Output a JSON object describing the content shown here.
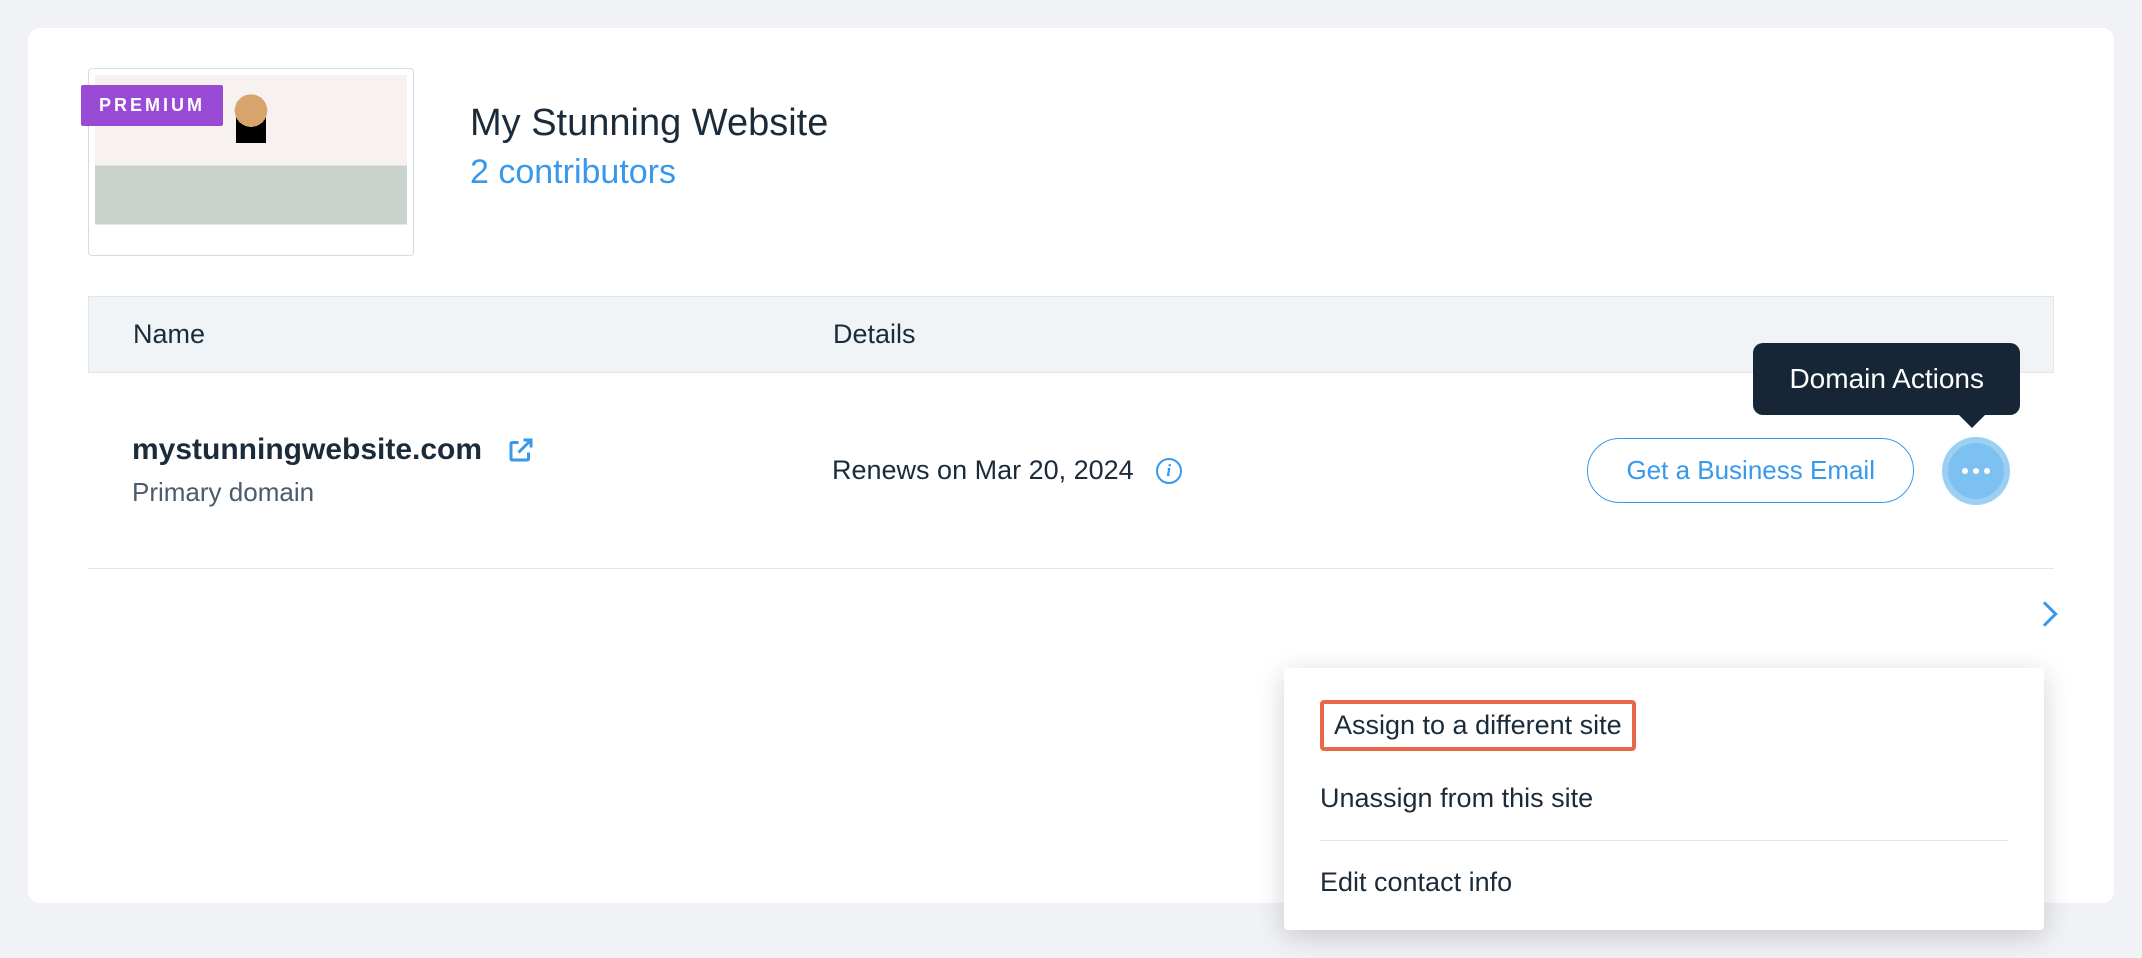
{
  "badge": {
    "label": "PREMIUM"
  },
  "site": {
    "title": "My Stunning Website",
    "contributors_label": "2 contributors"
  },
  "table": {
    "columns": {
      "name": "Name",
      "details": "Details"
    }
  },
  "domain": {
    "name": "mystunningwebsite.com",
    "subtitle": "Primary domain",
    "renewal": "Renews on Mar 20, 2024"
  },
  "actions": {
    "business_email_label": "Get a Business Email",
    "tooltip": "Domain Actions",
    "menu": {
      "assign": "Assign to a different site",
      "unassign": "Unassign from this site",
      "edit_contact": "Edit contact info"
    }
  }
}
